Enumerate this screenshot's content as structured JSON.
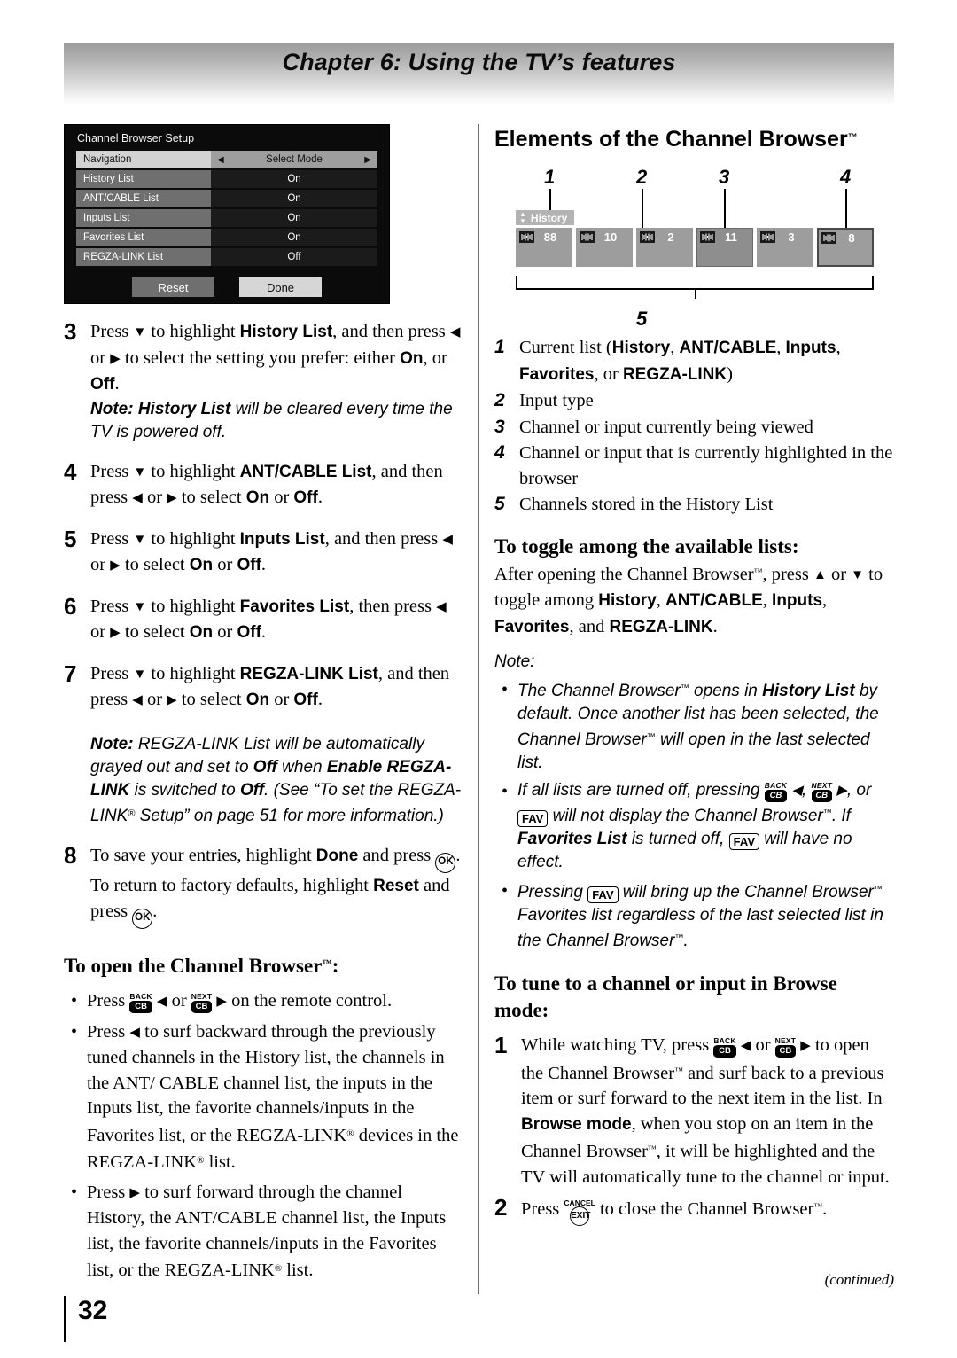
{
  "header": {
    "chapter_title": "Chapter 6: Using the TV’s features"
  },
  "footer": {
    "page_number": "32",
    "continued": "(continued)"
  },
  "osd": {
    "title": "Channel Browser Setup",
    "rows": [
      {
        "label": "Navigation",
        "value": "Select Mode",
        "selected": true
      },
      {
        "label": "History List",
        "value": "On"
      },
      {
        "label": "ANT/CABLE List",
        "value": "On"
      },
      {
        "label": "Inputs List",
        "value": "On"
      },
      {
        "label": "Favorites List",
        "value": "On"
      },
      {
        "label": "REGZA-LINK List",
        "value": "Off"
      }
    ],
    "buttons": {
      "reset": "Reset",
      "done": "Done"
    }
  },
  "left_column": {
    "steps": [
      {
        "num": "3",
        "text_html": "Press <span class=\"tri\">▼</span> to highlight <span class=\"b\">History List</span>, and then press <span class=\"tri\">◀</span> or <span class=\"tri\">▶</span> to select the setting you prefer: either <span class=\"b\">On</span>, or <span class=\"b\">Off</span>.",
        "note_html": "<b>Note: History List</b> will be cleared every time the TV is powered off."
      },
      {
        "num": "4",
        "text_html": "Press <span class=\"tri\">▼</span> to highlight <span class=\"b\">ANT/CABLE List</span>, and then press <span class=\"tri\">◀</span> or <span class=\"tri\">▶</span> to select <span class=\"b\">On</span> or <span class=\"b\">Off</span>."
      },
      {
        "num": "5",
        "text_html": "Press <span class=\"tri\">▼</span> to highlight <span class=\"b\">Inputs List</span>, and then press <span class=\"tri\">◀</span> or <span class=\"tri\">▶</span> to select <span class=\"b\">On</span> or <span class=\"b\">Off</span>."
      },
      {
        "num": "6",
        "text_html": "Press <span class=\"tri\">▼</span> to highlight <span class=\"b\">Favorites List</span>, then press <span class=\"tri\">◀</span> or <span class=\"tri\">▶</span> to select <span class=\"b\">On</span> or <span class=\"b\">Off</span>."
      },
      {
        "num": "7",
        "text_html": "Press <span class=\"tri\">▼</span> to highlight <span class=\"b\">REGZA-LINK List</span>, and then press <span class=\"tri\">◀</span> or <span class=\"tri\">▶</span> to select <span class=\"b\">On</span> or <span class=\"b\">Off</span>."
      }
    ],
    "regza_note_html": "<b>Note:</b> REGZA-LINK List will be automatically grayed out and set to <b>Off</b> when <b>Enable REGZA-LINK</b> is switched to <b>Off</b>. (See “To set the REGZA-LINK<span class=\"reg\">®</span> Setup” on page 51 for more information.)",
    "step8": {
      "num": "8",
      "text_html": "To save your entries, highlight <span class=\"b\">Done</span> and press <span class=\"ok\">OK</span>. To return to factory defaults, highlight <span class=\"b\">Reset</span> and press <span class=\"ok\">OK</span>."
    },
    "open_heading": "To open the Channel Browser",
    "open_heading_tm": "™",
    "open_heading_colon": ":",
    "open_bullets": [
      "Press <span class=\"key\"><span class=\"cap\">BACK</span><span class=\"body\">CB</span></span> <span class=\"tri\">◀</span> or <span class=\"key\"><span class=\"cap\">NEXT</span><span class=\"body\">CB</span></span> <span class=\"tri\">▶</span> on the remote control.",
      "Press <span class=\"tri\">◀</span> to surf backward through the previously tuned channels in the History list, the channels in the ANT/ CABLE channel list, the inputs in the Inputs list, the favorite channels/inputs in the Favorites list, or the REGZA-LINK<span class=\"reg\">®</span> devices in the REGZA-LINK<span class=\"reg\">®</span> list.",
      "Press <span class=\"tri\">▶</span> to surf forward through the channel History, the ANT/CABLE channel list, the Inputs list, the favorite channels/inputs in the Favorites list, or the REGZA-LINK<span class=\"reg\">®</span> list."
    ]
  },
  "right_column": {
    "heading": "Elements of the Channel Browser",
    "heading_tm": "™",
    "diagram": {
      "callout_numbers": [
        "1",
        "2",
        "3",
        "4",
        "5"
      ],
      "list_label": "History",
      "tiles": [
        {
          "channel": "88",
          "state": "first"
        },
        {
          "channel": "10",
          "state": "normal"
        },
        {
          "channel": "2",
          "state": "normal"
        },
        {
          "channel": "11",
          "state": "viewing"
        },
        {
          "channel": "3",
          "state": "normal"
        },
        {
          "channel": "8",
          "state": "highlighted"
        }
      ]
    },
    "elements_list": [
      {
        "num": "1",
        "text_html": "Current list (<span class=\"b\">History</span>, <span class=\"b\">ANT/CABLE</span>, <span class=\"b\">Inputs</span>, <span class=\"b\">Favorites</span>, or <span class=\"b\">REGZA-LINK</span>)"
      },
      {
        "num": "2",
        "text_html": "Input type"
      },
      {
        "num": "3",
        "text_html": "Channel or input currently being viewed"
      },
      {
        "num": "4",
        "text_html": "Channel or input that is currently highlighted in the browser"
      },
      {
        "num": "5",
        "text_html": "Channels stored in the History List"
      }
    ],
    "toggle_heading": "To toggle among the available lists:",
    "toggle_body_html": "After opening the Channel Browser<span class=\"tm-s\">™</span>, press <span class=\"tri\">▲</span> or <span class=\"tri\">▼</span> to toggle among <span class=\"b\">History</span>, <span class=\"b\">ANT/CABLE</span>, <span class=\"b\">Inputs</span>, <span class=\"b\">Favorites</span>, and <span class=\"b\">REGZA-LINK</span>.",
    "note_label": "Note:",
    "note_bullets": [
      "The Channel Browser<span class=\"tm-s\">™</span> opens in <b>History List</b> by default. Once another list has been selected, the Channel Browser<span class=\"tm-s\">™</span> will open in the last selected list.",
      "If all lists are turned off, pressing <span class=\"key\"><span class=\"cap\">BACK</span><span class=\"body\">CB</span></span> <span class=\"tri\">◀</span>, <span class=\"key\"><span class=\"cap\">NEXT</span><span class=\"body\">CB</span></span> <span class=\"tri\">▶</span>, or <span class=\"fav\">FAV</span> will not display the Channel Browser<span class=\"tm-s\">™</span>. If <b>Favorites List</b> is turned off, <span class=\"fav\">FAV</span> will have no effect.",
      "Pressing <span class=\"fav\">FAV</span> will bring up the Channel Browser<span class=\"tm-s\">™</span> Favorites list regardless of the last selected list in the Channel Browser<span class=\"tm-s\">™</span>."
    ],
    "tune_heading": "To tune to a channel or input in Browse mode:",
    "tune_steps": [
      {
        "num": "1",
        "text_html": "While watching TV, press <span class=\"key\"><span class=\"cap\">BACK</span><span class=\"body\">CB</span></span> <span class=\"tri\">◀</span> or <span class=\"key\"><span class=\"cap\">NEXT</span><span class=\"body\">CB</span></span> <span class=\"tri\">▶</span> to open the Channel Browser<span class=\"tm-s\">™</span> and surf back to a previous item or surf forward to the next item in the list. In <span class=\"b\">Browse mode</span>, when you stop on an item in the Channel Browser<span class=\"tm-s\">™</span>, it will be highlighted and the TV will automatically tune to the channel or input."
      },
      {
        "num": "2",
        "text_html": "Press <span class=\"keyc\"><span class=\"cap\">CANCEL</span><span class=\"circ\">EXIT</span></span> to close the Channel Browser<span class=\"tm-s\">™</span>."
      }
    ]
  }
}
